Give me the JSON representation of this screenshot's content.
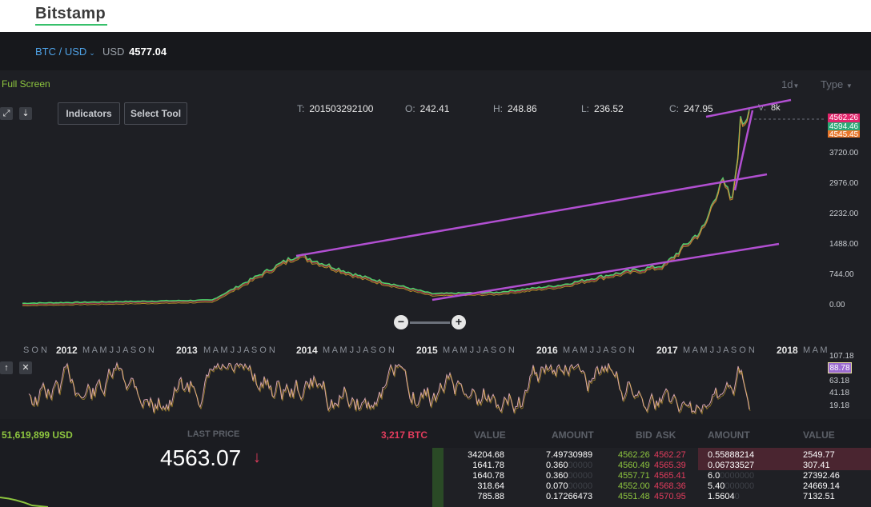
{
  "brand": {
    "logo": "Bitstamp"
  },
  "pair": {
    "symbol": "BTC / USD",
    "currency": "USD",
    "price": "4577.04"
  },
  "chart_controls": {
    "fullscreen": "Full Screen",
    "interval": "1d",
    "type": "Type",
    "indicators": "Indicators",
    "select_tool": "Select Tool",
    "zoom_out": "−",
    "zoom_in": "+"
  },
  "ohlc": {
    "t_label": "T:",
    "t": "201503292100",
    "o_label": "O:",
    "o": "242.41",
    "h_label": "H:",
    "h": "248.86",
    "l_label": "L:",
    "l": "236.52",
    "c_label": "C:",
    "c": "247.95",
    "v_label": "V:",
    "v": "8k"
  },
  "price_axis": {
    "ticks": [
      "3720.00",
      "2976.00",
      "2232.00",
      "1488.00",
      "744.00",
      "0.00"
    ],
    "badges": [
      {
        "text": "4562.26",
        "color": "#e2246b"
      },
      {
        "text": "4594.46",
        "color": "#2aa876"
      },
      {
        "text": "4545.45",
        "color": "#e8762a"
      }
    ]
  },
  "time_axis": {
    "months": "S O N",
    "years": [
      "2012",
      "2013",
      "2014",
      "2015",
      "2016",
      "2017",
      "2018"
    ],
    "month_groups": [
      "M A M J J A S O N",
      "M A M J J A S O N",
      "M A M J J A S O N",
      "M A M J J A S O N",
      "M A M J J A S O N",
      "M A M J J A S O N",
      "M A M"
    ]
  },
  "chart_data": {
    "type": "line",
    "title": "",
    "x": [
      "2011-09",
      "2013-03",
      "2013-11",
      "2014-06",
      "2015-01",
      "2015-07",
      "2016-01",
      "2016-07",
      "2017-01",
      "2017-05",
      "2017-06",
      "2017-07",
      "2017-08",
      "2017-09"
    ],
    "series": [
      {
        "values": [
          5,
          80,
          1150,
          640,
          230,
          260,
          430,
          670,
          900,
          1800,
          2900,
          2400,
          4200,
          4562
        ]
      }
    ],
    "ylim": [
      0,
      4600
    ],
    "trendlines": 4,
    "trendline_color": "#b14fd1"
  },
  "oscillator": {
    "ticks": [
      "107.18",
      "63.18",
      "41.18",
      "19.18"
    ],
    "value": "88.78"
  },
  "summary": {
    "volume_usd": "51,619,899 USD",
    "last_price_label": "LAST PRICE",
    "last_price": "4563.07",
    "down_arrow": "↓",
    "volume_btc": "3,217 BTC"
  },
  "orderbook": {
    "headers": [
      "VALUE",
      "AMOUNT",
      "BID",
      "ASK",
      "AMOUNT",
      "VALUE"
    ],
    "rows": [
      {
        "v1": "34204.68",
        "a1": "7.49730989",
        "bid": "4562.26",
        "ask": "4562.27",
        "a2": "0.55888214",
        "v2": "2549.77"
      },
      {
        "v1": "1641.78",
        "a1": "0.360",
        "a1dim": "00000",
        "bid": "4560.49",
        "ask": "4565.39",
        "a2": "0.06733527",
        "v2": "307.41"
      },
      {
        "v1": "1640.78",
        "a1": "0.360",
        "a1dim": "00000",
        "bid": "4557.71",
        "ask": "4565.41",
        "a2": "6.0",
        "a2dim": "0000000",
        "v2": "27392.46"
      },
      {
        "v1": "318.64",
        "a1": "0.070",
        "a1dim": "00000",
        "bid": "4552.00",
        "ask": "4568.36",
        "a2": "5.40",
        "a2dim": "000000",
        "v2": "24669.14"
      },
      {
        "v1": "785.88",
        "a1": "0.17266473",
        "bid": "4551.48",
        "ask": "4570.95",
        "a2": "1.5604",
        "a2dim": "0",
        "v2": "7132.51"
      }
    ]
  }
}
